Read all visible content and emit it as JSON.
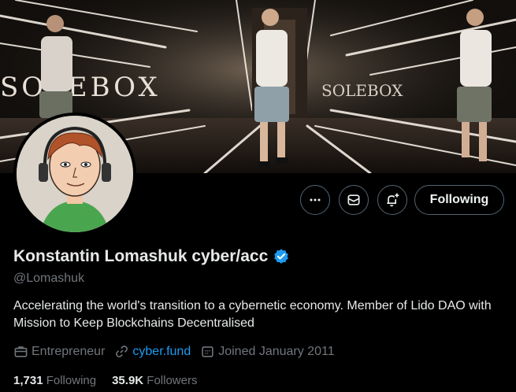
{
  "banner": {
    "sign_left": "SOLEBOX",
    "sign_right": "SOLEBOX"
  },
  "actions": {
    "more_label": "More",
    "message_label": "Message",
    "notify_label": "Turn on notifications",
    "follow_label": "Following"
  },
  "profile": {
    "name": "Konstantin Lomashuk cyber/acc",
    "handle": "@Lomashuk",
    "bio": "Accelerating the world's transition to a cybernetic economy.  Member of Lido DAO with Mission to Keep Blockchains Decentralised",
    "profession": "Entrepreneur",
    "website": "cyber.fund",
    "joined": "Joined January 2011"
  },
  "stats": {
    "following_count": "1,731",
    "following_label": "Following",
    "followers_count": "35.9K",
    "followers_label": "Followers"
  },
  "colors": {
    "background": "#000000",
    "text_primary": "#e7e9ea",
    "text_secondary": "#71767b",
    "link": "#1d9bf0",
    "verified": "#1d9bf0",
    "button_border": "#536471"
  },
  "icons": {
    "more": "more-dots-icon",
    "message": "envelope-icon",
    "notify": "bell-plus-icon",
    "verified": "verified-badge-icon",
    "profession": "briefcase-icon",
    "website": "link-icon",
    "joined": "calendar-icon"
  }
}
